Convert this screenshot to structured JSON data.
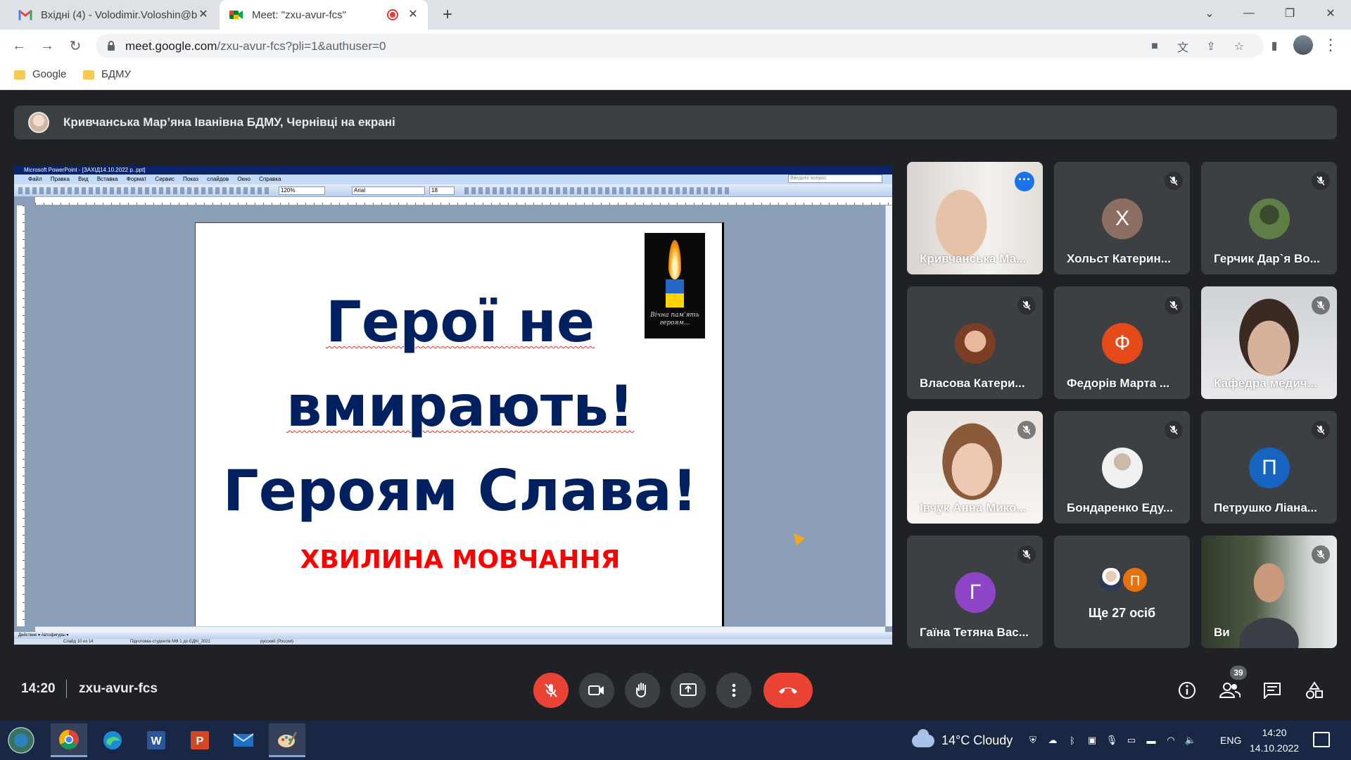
{
  "browser": {
    "tabs": [
      {
        "label": "Вхідні (4) - Volodimir.Voloshin@b"
      },
      {
        "label": "Meet: \"zxu-avur-fcs\""
      }
    ],
    "url_host": "meet.google.com",
    "url_path": "/zxu-avur-fcs?pli=1&authuser=0",
    "bookmarks": [
      "Google",
      "БДМУ"
    ]
  },
  "meet": {
    "presenter_banner": "Кривчанська Мар’яна Іванівна БДМУ, Чернівці на екрані",
    "time": "14:20",
    "meeting_code": "zxu-avur-fcs",
    "participant_count": "39",
    "colors": {
      "accent": "#1a73e8",
      "danger": "#ea4335",
      "bg": "#202124",
      "tile": "#3c4043"
    },
    "tiles": [
      {
        "name": "Кривчанська Ма..."
      },
      {
        "name": "Хольст Катерин...",
        "initial": "Х",
        "color": "#8d6e63"
      },
      {
        "name": "Герчик Дар`я Во..."
      },
      {
        "name": "Власова Катери..."
      },
      {
        "name": "Федорів Марта ...",
        "initial": "Ф",
        "color": "#e64a19"
      },
      {
        "name": "Кафедра медич..."
      },
      {
        "name": "Івчук Анна Мико..."
      },
      {
        "name": "Бондаренко Еду..."
      },
      {
        "name": "Петрушко Ліана...",
        "initial": "П",
        "color": "#1565c0"
      },
      {
        "name": "Гаїна Тетяна Вас...",
        "initial": "Г",
        "color": "#8e44c7"
      },
      {
        "more_initial": "П",
        "more_text": "Ще 27 осіб"
      },
      {
        "name": "Ви"
      }
    ]
  },
  "slide": {
    "app_title": "Microsoft PowerPoint - [ЗАХІД14.10.2022 р..ppt]",
    "menu": "Файл Правка Вид Вставка Формат Сервис Показ слайдов Окно Справка",
    "question_box": "Введите вопрос",
    "zoom": "120%",
    "font": "Arial",
    "font_size": "18",
    "line1": "Герої не",
    "line2": "вмирають!",
    "line3": "Героям Слава!",
    "line4": "ХВИЛИНА МОВЧАННЯ",
    "candle_caption": "Вічна пам'ять героям...",
    "draw_toolbar": "Действия ▾   Автофигуры ▾",
    "status_slide": "Слайд 10 из 14",
    "status_design": "Підготовка студентів МФ 1 до ЄДКІ_2021",
    "status_lang": "русский (Россия)"
  },
  "taskbar": {
    "weather": "14°C  Cloudy",
    "lang": "ENG",
    "time": "14:20",
    "date": "14.10.2022"
  }
}
